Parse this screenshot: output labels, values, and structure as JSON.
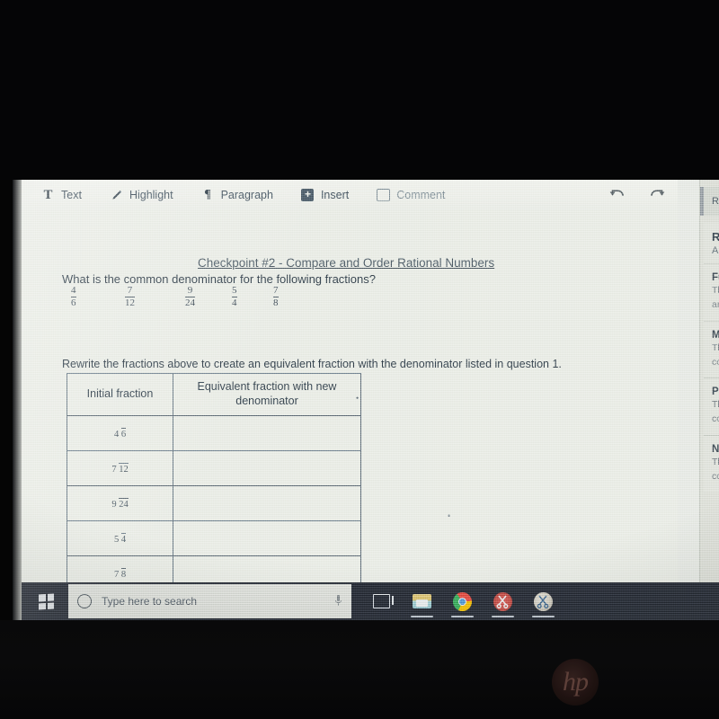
{
  "device": {
    "brand_logo": "hp",
    "logo_icon": "hp-logo"
  },
  "toolbar": {
    "items": [
      {
        "label": "Text",
        "icon": "text-icon"
      },
      {
        "label": "Highlight",
        "icon": "highlighter-icon"
      },
      {
        "label": "Paragraph",
        "icon": "paragraph-icon"
      },
      {
        "label": "Insert",
        "icon": "insert-plus-icon"
      },
      {
        "label": "Comment",
        "icon": "comment-icon"
      }
    ],
    "undo_icon": "undo-arrow-icon",
    "redo_icon": "redo-arrow-icon"
  },
  "document": {
    "title": "Checkpoint #2 - Compare and Order Rational Numbers",
    "question_1": "What is the common denominator for the following fractions?",
    "question_1_fractions": [
      {
        "numerator": "4",
        "denominator": "6"
      },
      {
        "numerator": "7",
        "denominator": "12"
      },
      {
        "numerator": "9",
        "denominator": "24"
      },
      {
        "numerator": "5",
        "denominator": "4"
      },
      {
        "numerator": "7",
        "denominator": "8"
      }
    ],
    "question_2": "Rewrite the fractions above to create an equivalent fraction with the denominator listed in question 1.",
    "table": {
      "headers": [
        "Initial fraction",
        "Equivalent fraction with new denominator"
      ],
      "rows": [
        {
          "numerator": "4",
          "denominator": "6",
          "answer": ""
        },
        {
          "numerator": "7",
          "denominator": "12",
          "answer": ""
        },
        {
          "numerator": "9",
          "denominator": "24",
          "answer": ""
        },
        {
          "numerator": "5",
          "denominator": "4",
          "answer": ""
        },
        {
          "numerator": "7",
          "denominator": "8",
          "answer": ""
        }
      ]
    }
  },
  "sidebar": {
    "tab_label": "Rati",
    "heading": "Rat",
    "subheading": "Appl",
    "rows": [
      {
        "title": "Full",
        "line1": "Ther",
        "line2": "and"
      },
      {
        "title": "Mos",
        "line1": "Ther",
        "line2": "conc"
      },
      {
        "title": "Part",
        "line1": "Ther",
        "line2": "conc"
      },
      {
        "title": "Not",
        "line1": "Ther",
        "line2": "conc"
      }
    ]
  },
  "taskbar": {
    "start_icon": "windows-start-icon",
    "search_placeholder": "Type here to search",
    "search_icon": "search-circle-icon",
    "mic_icon": "microphone-icon",
    "pinned": [
      {
        "name": "task-view-icon"
      },
      {
        "name": "file-explorer-icon"
      },
      {
        "name": "chrome-icon"
      },
      {
        "name": "snipping-tool-icon"
      },
      {
        "name": "snip-sketch-icon"
      }
    ]
  },
  "colors": {
    "bezel": "#050506",
    "screen_paper": "#e6e9e2",
    "taskbar": "#20252e",
    "ink": "#2f3b45",
    "table_border": "#5c6973"
  }
}
